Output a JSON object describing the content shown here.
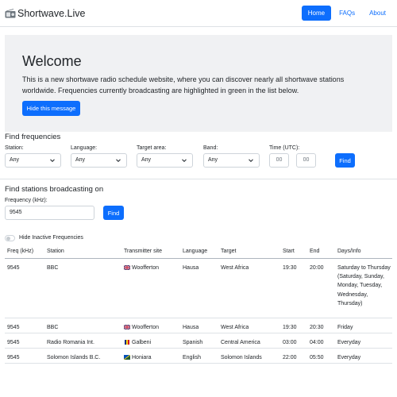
{
  "navbar": {
    "brand": "Shortwave.Live",
    "brand_icon": "radio-icon",
    "links": [
      {
        "label": "Home",
        "active": true
      },
      {
        "label": "FAQs",
        "active": false
      },
      {
        "label": "About",
        "active": false
      }
    ]
  },
  "welcome": {
    "title": "Welcome",
    "text": "This is a new shortwave radio schedule website, where you can discover nearly all shortwave stations worldwide. Frequencies currently broadcasting are highlighted in green in the list below.",
    "hide_button": "Hide this message"
  },
  "find_frequencies": {
    "title": "Find frequencies",
    "station_label": "Station:",
    "station_value": "Any",
    "language_label": "Language:",
    "language_value": "Any",
    "target_label": "Target area:",
    "target_value": "Any",
    "band_label": "Band:",
    "band_value": "Any",
    "time_label": "Time (UTC):",
    "time_hours_placeholder": "00",
    "time_minutes_placeholder": "00",
    "find_button": "Find"
  },
  "find_stations": {
    "title": "Find stations broadcasting on",
    "frequency_label": "Frequency (kHz):",
    "frequency_value": "9545",
    "find_button": "Find"
  },
  "toggle": {
    "label": "Hide Inactive Frequencies",
    "checked": false
  },
  "table": {
    "headers": [
      "Freq (kHz)",
      "Station",
      "Transmitter site",
      "Language",
      "Target",
      "Start",
      "End",
      "Days/Info"
    ],
    "rows": [
      {
        "freq": "9545",
        "station": "BBC",
        "flag": "uk",
        "site": "Woofferton",
        "language": "Hausa",
        "target": "West Africa",
        "start": "19:30",
        "end": "20:00",
        "days": "Saturday to Thursday (Saturday, Sunday, Monday, Tuesday, Wednesday, Thursday)"
      },
      {
        "freq": "9545",
        "station": "BBC",
        "flag": "uk",
        "site": "Woofferton",
        "language": "Hausa",
        "target": "West Africa",
        "start": "19:30",
        "end": "20:30",
        "days": "Friday"
      },
      {
        "freq": "9545",
        "station": "Radio Romania Int.",
        "flag": "ro",
        "site": "Galbeni",
        "language": "Spanish",
        "target": "Central America",
        "start": "03:00",
        "end": "04:00",
        "days": "Everyday"
      },
      {
        "freq": "9545",
        "station": "Solomon Islands B.C.",
        "flag": "sb",
        "site": "Honiara",
        "language": "English",
        "target": "Solomon Islands",
        "start": "22:00",
        "end": "05:50",
        "days": "Everyday"
      }
    ]
  },
  "colors": {
    "primary": "#0d6efd",
    "jumbotron_bg": "#f0f1f3",
    "border": "#dee2e6"
  }
}
